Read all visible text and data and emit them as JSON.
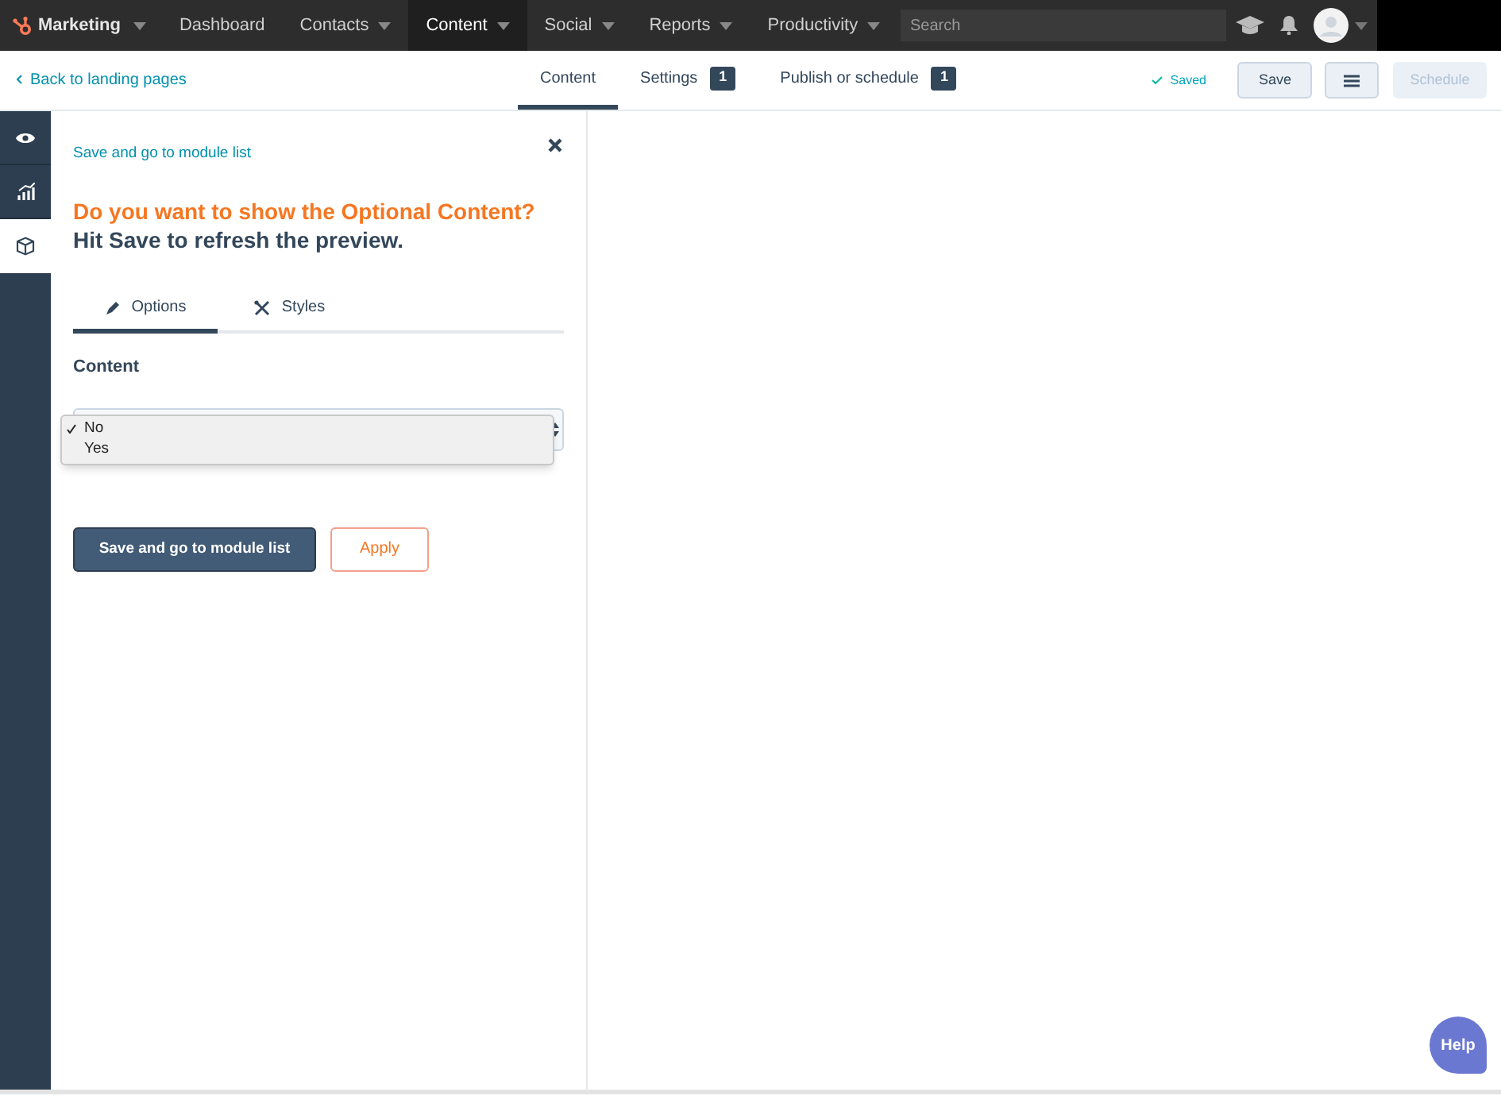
{
  "nav": {
    "brand": "Marketing",
    "items": [
      {
        "label": "Dashboard",
        "caret": false,
        "selected": false
      },
      {
        "label": "Contacts",
        "caret": true,
        "selected": false
      },
      {
        "label": "Content",
        "caret": true,
        "selected": true
      },
      {
        "label": "Social",
        "caret": true,
        "selected": false
      },
      {
        "label": "Reports",
        "caret": true,
        "selected": false
      },
      {
        "label": "Productivity",
        "caret": true,
        "selected": false
      }
    ],
    "search": {
      "placeholder": "Search"
    }
  },
  "toolbar": {
    "back": "Back to landing pages",
    "tabs": [
      {
        "label": "Content",
        "selected": true
      },
      {
        "label": "Settings",
        "badge": "1",
        "selected": false
      },
      {
        "label": "Publish or schedule",
        "badge": "1",
        "selected": false
      }
    ],
    "status": "Saved",
    "save": "Save",
    "schedule": {
      "label": "Schedule",
      "disabled": true
    }
  },
  "rail": [
    {
      "kind": "eye",
      "selected": false
    },
    {
      "kind": "chart",
      "selected": false
    },
    {
      "kind": "cube",
      "selected": true
    }
  ],
  "panel": {
    "link": "Save and go to module list",
    "question": "Do you want to show the Optional Content?",
    "hint": "Hit Save to refresh the preview.",
    "tabs": [
      {
        "kind": "pencil",
        "label": "Options",
        "selected": true
      },
      {
        "kind": "tools",
        "label": "Styles",
        "selected": false
      }
    ],
    "section": "Content",
    "options": [
      {
        "label": "No",
        "selected": true
      },
      {
        "label": "Yes",
        "selected": false
      }
    ],
    "primary": "Save and go to module list",
    "secondary": "Apply"
  },
  "help": "Help"
}
